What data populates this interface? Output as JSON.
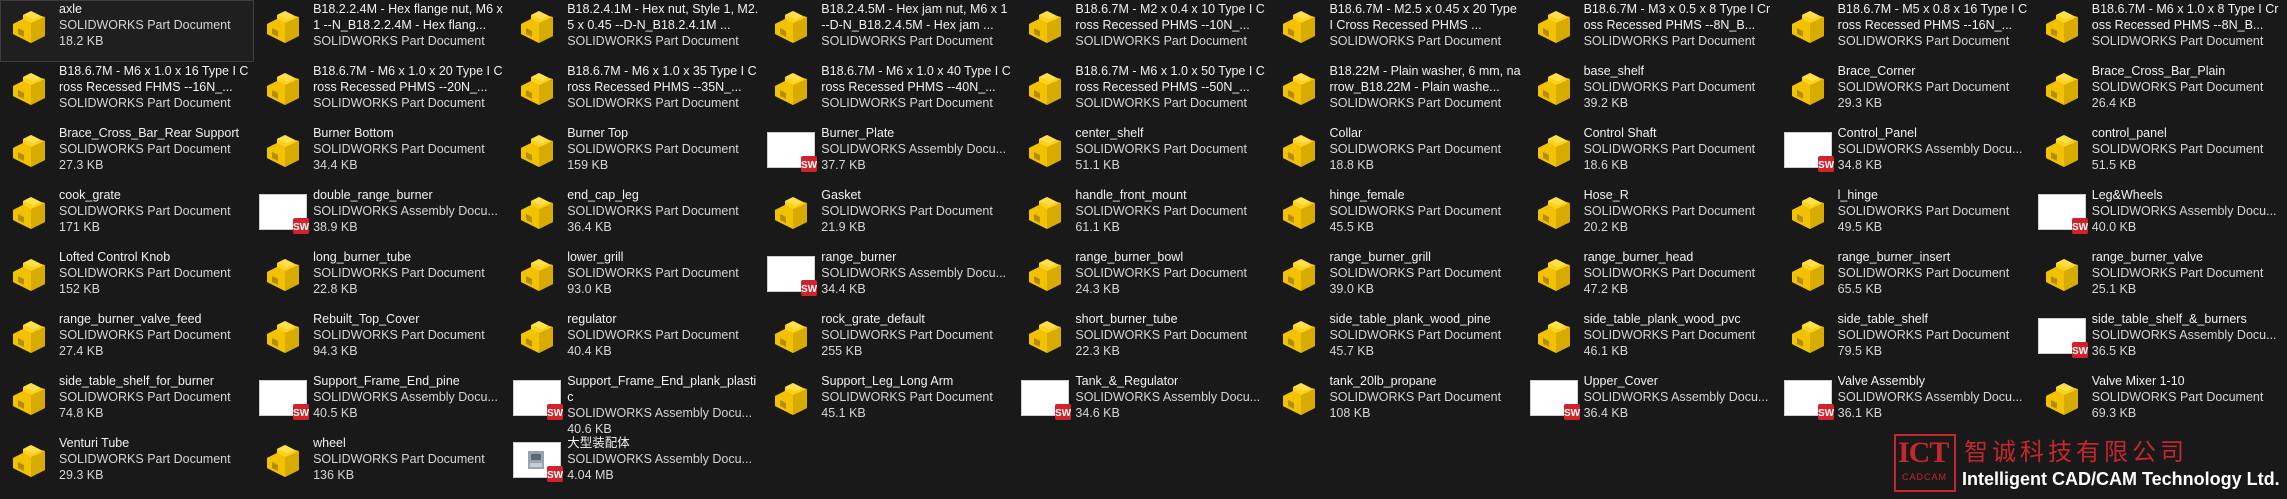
{
  "window": {
    "view": "file-explorer-large-icons"
  },
  "type_labels": {
    "part": "SOLIDWORKS Part Document",
    "assembly": "SOLIDWORKS Assembly Docu..."
  },
  "files": [
    {
      "name": "axle",
      "kind": "part",
      "type": "SOLIDWORKS Part Document",
      "size": "18.2 KB",
      "selected": true
    },
    {
      "name": "B18.2.2.4M - Hex flange nut, M6 x 1 --N_B18.2.2.4M - Hex flang...",
      "kind": "part",
      "type": "SOLIDWORKS Part Document"
    },
    {
      "name": "B18.2.4.1M - Hex nut, Style 1, M2.5 x 0.45 --D-N_B18.2.4.1M ...",
      "kind": "part",
      "type": "SOLIDWORKS Part Document"
    },
    {
      "name": "B18.2.4.5M - Hex jam nut,  M6 x 1 --D-N_B18.2.4.5M - Hex jam ...",
      "kind": "part",
      "type": "SOLIDWORKS Part Document"
    },
    {
      "name": "B18.6.7M - M2 x 0.4 x 10 Type I Cross Recessed PHMS --10N_...",
      "kind": "part",
      "type": "SOLIDWORKS Part Document"
    },
    {
      "name": "B18.6.7M - M2.5 x 0.45 x 20 Type I Cross Recessed PHMS ...",
      "kind": "part",
      "type": "SOLIDWORKS Part Document"
    },
    {
      "name": "B18.6.7M - M3 x 0.5 x 8 Type I Cross Recessed PHMS --8N_B...",
      "kind": "part",
      "type": "SOLIDWORKS Part Document"
    },
    {
      "name": "B18.6.7M - M5 x 0.8 x 16 Type I Cross Recessed PHMS --16N_...",
      "kind": "part",
      "type": "SOLIDWORKS Part Document"
    },
    {
      "name": "B18.6.7M - M6 x 1.0 x 8 Type I Cross Recessed PHMS --8N_B...",
      "kind": "part",
      "type": "SOLIDWORKS Part Document"
    },
    {
      "name": "B18.6.7M - M6 x 1.0 x 16 Type I Cross Recessed FHMS --16N_...",
      "kind": "part",
      "type": "SOLIDWORKS Part Document"
    },
    {
      "name": "B18.6.7M - M6 x 1.0 x 20 Type I Cross Recessed PHMS --20N_...",
      "kind": "part",
      "type": "SOLIDWORKS Part Document"
    },
    {
      "name": "B18.6.7M - M6 x 1.0 x 35 Type I Cross Recessed PHMS --35N_...",
      "kind": "part",
      "type": "SOLIDWORKS Part Document"
    },
    {
      "name": "B18.6.7M - M6 x 1.0 x 40 Type I Cross Recessed PHMS --40N_...",
      "kind": "part",
      "type": "SOLIDWORKS Part Document"
    },
    {
      "name": "B18.6.7M - M6 x 1.0 x 50 Type I Cross Recessed PHMS --50N_...",
      "kind": "part",
      "type": "SOLIDWORKS Part Document"
    },
    {
      "name": "B18.22M - Plain washer, 6 mm, narrow_B18.22M - Plain washe...",
      "kind": "part",
      "type": "SOLIDWORKS Part Document"
    },
    {
      "name": "base_shelf",
      "kind": "part",
      "type": "SOLIDWORKS Part Document",
      "size": "39.2 KB"
    },
    {
      "name": "Brace_Corner",
      "kind": "part",
      "type": "SOLIDWORKS Part Document",
      "size": "29.3 KB"
    },
    {
      "name": "Brace_Cross_Bar_Plain",
      "kind": "part",
      "type": "SOLIDWORKS Part Document",
      "size": "26.4 KB"
    },
    {
      "name": "Brace_Cross_Bar_Rear Support",
      "kind": "part",
      "type": "SOLIDWORKS Part Document",
      "size": "27.3 KB"
    },
    {
      "name": "Burner Bottom",
      "kind": "part",
      "type": "SOLIDWORKS Part Document",
      "size": "34.4 KB"
    },
    {
      "name": "Burner Top",
      "kind": "part",
      "type": "SOLIDWORKS Part Document",
      "size": "159 KB"
    },
    {
      "name": "Burner_Plate",
      "kind": "assembly",
      "type": "SOLIDWORKS Assembly Docu...",
      "size": "37.7 KB"
    },
    {
      "name": "center_shelf",
      "kind": "part",
      "type": "SOLIDWORKS Part Document",
      "size": "51.1 KB"
    },
    {
      "name": "Collar",
      "kind": "part",
      "type": "SOLIDWORKS Part Document",
      "size": "18.8 KB"
    },
    {
      "name": "Control Shaft",
      "kind": "part",
      "type": "SOLIDWORKS Part Document",
      "size": "18.6 KB"
    },
    {
      "name": "Control_Panel",
      "kind": "assembly",
      "type": "SOLIDWORKS Assembly Docu...",
      "size": "34.8 KB"
    },
    {
      "name": "control_panel",
      "kind": "part",
      "type": "SOLIDWORKS Part Document",
      "size": "51.5 KB"
    },
    {
      "name": "cook_grate",
      "kind": "part",
      "type": "SOLIDWORKS Part Document",
      "size": "171 KB"
    },
    {
      "name": "double_range_burner",
      "kind": "assembly",
      "type": "SOLIDWORKS Assembly Docu...",
      "size": "38.9 KB"
    },
    {
      "name": "end_cap_leg",
      "kind": "part",
      "type": "SOLIDWORKS Part Document",
      "size": "36.4 KB"
    },
    {
      "name": "Gasket",
      "kind": "part",
      "type": "SOLIDWORKS Part Document",
      "size": "21.9 KB"
    },
    {
      "name": "handle_front_mount",
      "kind": "part",
      "type": "SOLIDWORKS Part Document",
      "size": "61.1 KB"
    },
    {
      "name": "hinge_female",
      "kind": "part",
      "type": "SOLIDWORKS Part Document",
      "size": "45.5 KB"
    },
    {
      "name": "Hose_R",
      "kind": "part",
      "type": "SOLIDWORKS Part Document",
      "size": "20.2 KB"
    },
    {
      "name": "l_hinge",
      "kind": "part",
      "type": "SOLIDWORKS Part Document",
      "size": "49.5 KB"
    },
    {
      "name": "Leg&Wheels",
      "kind": "assembly",
      "type": "SOLIDWORKS Assembly Docu...",
      "size": "40.0 KB"
    },
    {
      "name": "Lofted Control Knob",
      "kind": "part",
      "type": "SOLIDWORKS Part Document",
      "size": "152 KB"
    },
    {
      "name": "long_burner_tube",
      "kind": "part",
      "type": "SOLIDWORKS Part Document",
      "size": "22.8 KB"
    },
    {
      "name": "lower_grill",
      "kind": "part",
      "type": "SOLIDWORKS Part Document",
      "size": "93.0 KB"
    },
    {
      "name": "range_burner",
      "kind": "assembly",
      "type": "SOLIDWORKS Assembly Docu...",
      "size": "34.4 KB"
    },
    {
      "name": "range_burner_bowl",
      "kind": "part",
      "type": "SOLIDWORKS Part Document",
      "size": "24.3 KB"
    },
    {
      "name": "range_burner_grill",
      "kind": "part",
      "type": "SOLIDWORKS Part Document",
      "size": "39.0 KB"
    },
    {
      "name": "range_burner_head",
      "kind": "part",
      "type": "SOLIDWORKS Part Document",
      "size": "47.2 KB"
    },
    {
      "name": "range_burner_insert",
      "kind": "part",
      "type": "SOLIDWORKS Part Document",
      "size": "65.5 KB"
    },
    {
      "name": "range_burner_valve",
      "kind": "part",
      "type": "SOLIDWORKS Part Document",
      "size": "25.1 KB"
    },
    {
      "name": "range_burner_valve_feed",
      "kind": "part",
      "type": "SOLIDWORKS Part Document",
      "size": "27.4 KB"
    },
    {
      "name": "Rebuilt_Top_Cover",
      "kind": "part",
      "type": "SOLIDWORKS Part Document",
      "size": "94.3 KB"
    },
    {
      "name": "regulator",
      "kind": "part",
      "type": "SOLIDWORKS Part Document",
      "size": "40.4 KB"
    },
    {
      "name": "rock_grate_default",
      "kind": "part",
      "type": "SOLIDWORKS Part Document",
      "size": "255 KB"
    },
    {
      "name": "short_burner_tube",
      "kind": "part",
      "type": "SOLIDWORKS Part Document",
      "size": "22.3 KB"
    },
    {
      "name": "side_table_plank_wood_pine",
      "kind": "part",
      "type": "SOLIDWORKS Part Document",
      "size": "45.7 KB"
    },
    {
      "name": "side_table_plank_wood_pvc",
      "kind": "part",
      "type": "SOLIDWORKS Part Document",
      "size": "46.1 KB"
    },
    {
      "name": "side_table_shelf",
      "kind": "part",
      "type": "SOLIDWORKS Part Document",
      "size": "79.5 KB"
    },
    {
      "name": "side_table_shelf_&_burners",
      "kind": "assembly",
      "type": "SOLIDWORKS Assembly Docu...",
      "size": "36.5 KB"
    },
    {
      "name": "side_table_shelf_for_burner",
      "kind": "part",
      "type": "SOLIDWORKS Part Document",
      "size": "74.8 KB"
    },
    {
      "name": "Support_Frame_End_pine",
      "kind": "assembly",
      "type": "SOLIDWORKS Assembly Docu...",
      "size": "40.5 KB"
    },
    {
      "name": "Support_Frame_End_plank_plastic",
      "kind": "assembly",
      "type": "SOLIDWORKS Assembly Docu...",
      "size": "40.6 KB"
    },
    {
      "name": "Support_Leg_Long Arm",
      "kind": "part",
      "type": "SOLIDWORKS Part Document",
      "size": "45.1 KB"
    },
    {
      "name": "Tank_&_Regulator",
      "kind": "assembly",
      "type": "SOLIDWORKS Assembly Docu...",
      "size": "34.6 KB"
    },
    {
      "name": "tank_20lb_propane",
      "kind": "part",
      "type": "SOLIDWORKS Part Document",
      "size": "108 KB"
    },
    {
      "name": "Upper_Cover",
      "kind": "assembly",
      "type": "SOLIDWORKS Assembly Docu...",
      "size": "36.4 KB"
    },
    {
      "name": "Valve Assembly",
      "kind": "assembly",
      "type": "SOLIDWORKS Assembly Docu...",
      "size": "36.1 KB"
    },
    {
      "name": "Valve Mixer 1-10",
      "kind": "part",
      "type": "SOLIDWORKS Part Document",
      "size": "69.3 KB"
    },
    {
      "name": "Venturi Tube",
      "kind": "part",
      "type": "SOLIDWORKS Part Document",
      "size": "29.3 KB"
    },
    {
      "name": "wheel",
      "kind": "part",
      "type": "SOLIDWORKS Part Document",
      "size": "136 KB"
    },
    {
      "name": "大型装配体",
      "kind": "assembly-shot",
      "type": "SOLIDWORKS Assembly Docu...",
      "size": "4.04 MB"
    }
  ],
  "logo": {
    "icon": "ict-cadcam-logo-icon",
    "mark": "ICT",
    "mark_sub": "CADCAM",
    "chinese": "智诚科技有限公司",
    "english": "Intelligent CAD/CAM Technology Ltd.",
    "color": "#c2272d"
  },
  "colors": {
    "background": "#191919",
    "part_icon": "#f2c200",
    "sw_badge": "#d2232a"
  }
}
